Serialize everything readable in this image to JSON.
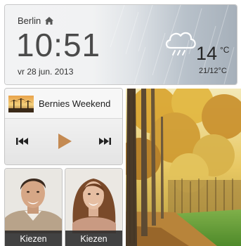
{
  "clock_widget": {
    "city": "Berlin",
    "time": "10:51",
    "date": "vr 28 jun. 2013",
    "temperature": "14",
    "temperature_unit": "°C",
    "temp_range": "21/12°C",
    "home_icon": "home-icon",
    "weather_icon": "cloud-rain-icon"
  },
  "music_widget": {
    "track_title": "Bernies Weekend",
    "album_art": "album-art-palm-sunset",
    "icons": [
      "previous-icon",
      "play-icon",
      "next-icon"
    ],
    "play_color": "#c48a52"
  },
  "contacts": [
    {
      "label": "Kiezen",
      "avatar": "contact-photo-man"
    },
    {
      "label": "Kiezen",
      "avatar": "contact-photo-woman"
    }
  ],
  "wallpaper": {
    "subject": "autumn-forest-path"
  }
}
